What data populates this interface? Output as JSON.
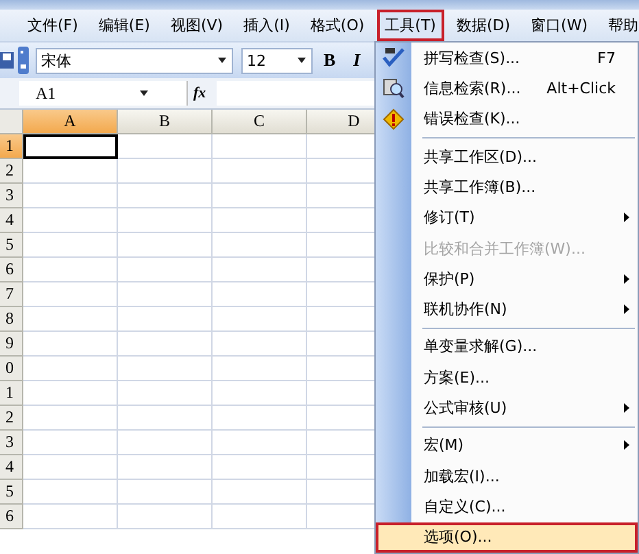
{
  "menu_bar": [
    {
      "label": "文件(F)",
      "selected": false
    },
    {
      "label": "编辑(E)",
      "selected": false
    },
    {
      "label": "视图(V)",
      "selected": false
    },
    {
      "label": "插入(I)",
      "selected": false
    },
    {
      "label": "格式(O)",
      "selected": false
    },
    {
      "label": "工具(T)",
      "selected": true
    },
    {
      "label": "数据(D)",
      "selected": false
    },
    {
      "label": "窗口(W)",
      "selected": false
    },
    {
      "label": "帮助",
      "selected": false
    }
  ],
  "toolbar": {
    "font": "宋体",
    "size": "12",
    "bold": "B",
    "italic": "I"
  },
  "formula_bar": {
    "name_box": "A1",
    "function_label": "fx"
  },
  "sheet": {
    "columns": [
      {
        "label": "A",
        "selected": true
      },
      {
        "label": "B",
        "selected": false
      },
      {
        "label": "C",
        "selected": false
      },
      {
        "label": "D",
        "selected": false
      }
    ],
    "rows": [
      {
        "label": "1",
        "selected": true
      },
      {
        "label": "2",
        "selected": false
      },
      {
        "label": "3",
        "selected": false
      },
      {
        "label": "4",
        "selected": false
      },
      {
        "label": "5",
        "selected": false
      },
      {
        "label": "6",
        "selected": false
      },
      {
        "label": "7",
        "selected": false
      },
      {
        "label": "8",
        "selected": false
      },
      {
        "label": "9",
        "selected": false
      },
      {
        "label": "0",
        "selected": false
      },
      {
        "label": "1",
        "selected": false
      },
      {
        "label": "2",
        "selected": false
      },
      {
        "label": "3",
        "selected": false
      },
      {
        "label": "4",
        "selected": false
      },
      {
        "label": "5",
        "selected": false
      },
      {
        "label": "6",
        "selected": false
      }
    ]
  },
  "tools_menu": [
    {
      "kind": "item",
      "label": "拼写检查(S)...",
      "shortcut": "F7",
      "submenu": false,
      "disabled": false,
      "selected": false
    },
    {
      "kind": "item",
      "label": "信息检索(R)...",
      "shortcut": "Alt+Click",
      "submenu": false,
      "disabled": false,
      "selected": false
    },
    {
      "kind": "item",
      "label": "错误检查(K)...",
      "submenu": false,
      "disabled": false,
      "selected": false
    },
    {
      "kind": "separator"
    },
    {
      "kind": "item",
      "label": "共享工作区(D)...",
      "submenu": false,
      "disabled": false,
      "selected": false
    },
    {
      "kind": "item",
      "label": "共享工作簿(B)...",
      "submenu": false,
      "disabled": false,
      "selected": false
    },
    {
      "kind": "item",
      "label": "修订(T)",
      "submenu": true,
      "disabled": false,
      "selected": false
    },
    {
      "kind": "item",
      "label": "比较和合并工作簿(W)...",
      "submenu": false,
      "disabled": true,
      "selected": false
    },
    {
      "kind": "item",
      "label": "保护(P)",
      "submenu": true,
      "disabled": false,
      "selected": false
    },
    {
      "kind": "item",
      "label": "联机协作(N)",
      "submenu": true,
      "disabled": false,
      "selected": false
    },
    {
      "kind": "separator"
    },
    {
      "kind": "item",
      "label": "单变量求解(G)...",
      "submenu": false,
      "disabled": false,
      "selected": false
    },
    {
      "kind": "item",
      "label": "方案(E)...",
      "submenu": false,
      "disabled": false,
      "selected": false
    },
    {
      "kind": "item",
      "label": "公式审核(U)",
      "submenu": true,
      "disabled": false,
      "selected": false
    },
    {
      "kind": "separator"
    },
    {
      "kind": "item",
      "label": "宏(M)",
      "submenu": true,
      "disabled": false,
      "selected": false
    },
    {
      "kind": "item",
      "label": "加载宏(I)...",
      "submenu": false,
      "disabled": false,
      "selected": false
    },
    {
      "kind": "item",
      "label": "自定义(C)...",
      "submenu": false,
      "disabled": false,
      "selected": false
    },
    {
      "kind": "item",
      "label": "选项(O)...",
      "submenu": false,
      "disabled": false,
      "selected": true
    }
  ]
}
